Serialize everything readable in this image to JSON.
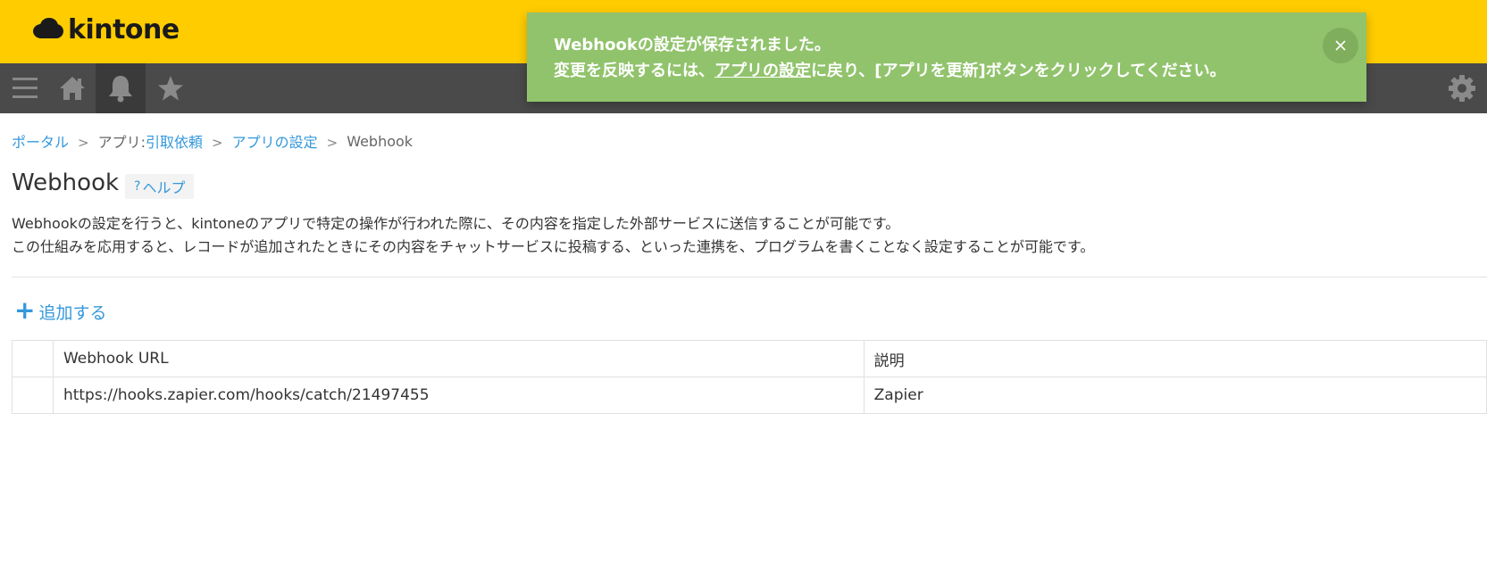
{
  "header": {
    "logo_text": "kintone",
    "brand_color": "#ffcc00",
    "navbar_color": "#4a4a4a",
    "nav_icons": [
      "menu-icon",
      "home-icon",
      "bell-icon",
      "star-icon",
      "gear-icon"
    ]
  },
  "toast": {
    "line1": "Webhookの設定が保存されました。",
    "line2_prefix": "変更を反映するには、",
    "line2_link": "アプリの設定",
    "line2_suffix": "に戻り、[アプリを更新]ボタンをクリックしてください。",
    "background": "#91c36c",
    "close_icon": "close-icon"
  },
  "breadcrumb": {
    "portal": "ポータル",
    "app_prefix": "アプリ: ",
    "app_name": "引取依頼",
    "app_settings": "アプリの設定",
    "current": "Webhook",
    "separator": ">"
  },
  "page": {
    "title": "Webhook",
    "help_label": "ヘルプ",
    "help_mark": "?",
    "description_line1": "Webhookの設定を行うと、kintoneのアプリで特定の操作が行われた際に、その内容を指定した外部サービスに送信することが可能です。",
    "description_line2": "この仕組みを応用すると、レコードが追加されたときにその内容をチャットサービスに投稿する、といった連携を、プログラムを書くことなく設定することが可能です。",
    "add_label": "追加する",
    "link_color": "#3498db"
  },
  "table": {
    "headers": [
      "",
      "Webhook URL",
      "説明"
    ],
    "rows": [
      {
        "url": "https://hooks.zapier.com/hooks/catch/21497455",
        "description": "Zapier"
      }
    ]
  }
}
